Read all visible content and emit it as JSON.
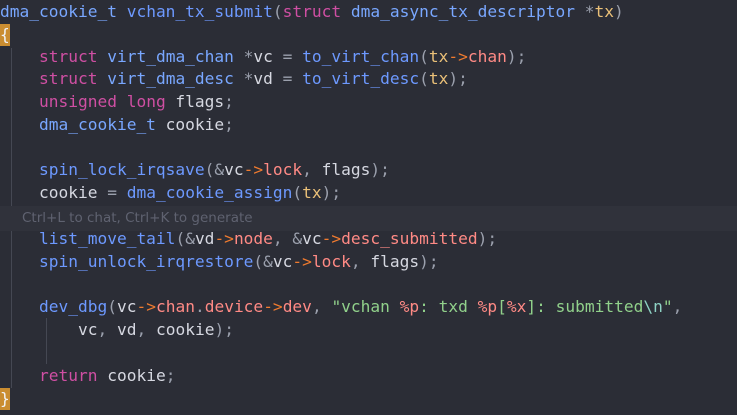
{
  "editor": {
    "hint": "Ctrl+L to chat, Ctrl+K to generate",
    "code_lines": [
      "dma_cookie_t vchan_tx_submit(struct dma_async_tx_descriptor *tx)",
      "{",
      "    struct virt_dma_chan *vc = to_virt_chan(tx->chan);",
      "    struct virt_dma_desc *vd = to_virt_desc(tx);",
      "    unsigned long flags;",
      "    dma_cookie_t cookie;",
      "",
      "    spin_lock_irqsave(&vc->lock, flags);",
      "    cookie = dma_cookie_assign(tx);",
      "    list_move_tail(&vd->node, &vc->desc_submitted);",
      "    spin_unlock_irqrestore(&vc->lock, flags);",
      "",
      "    dev_dbg(vc->chan.device->dev, \"vchan %p: txd %p[%x]: submitted\\n\",",
      "        vc, vd, cookie);",
      "",
      "    return cookie;",
      "}"
    ]
  }
}
